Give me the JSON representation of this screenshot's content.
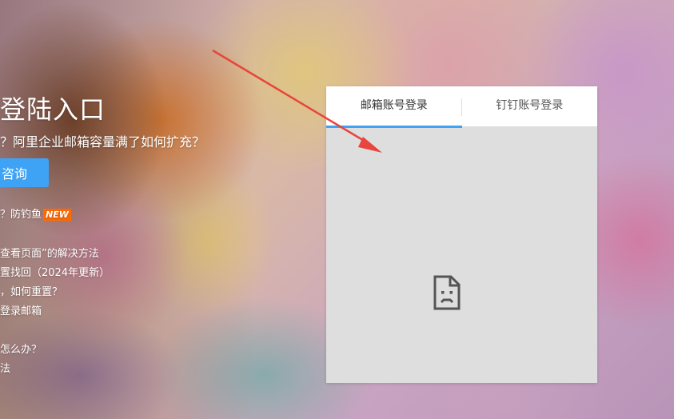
{
  "left": {
    "title": "登陆入口",
    "subtitle": "？阿里企业邮箱容量满了如何扩充？",
    "consult_button": "咨询",
    "notice": {
      "text": "？防钓鱼",
      "badge": "NEW"
    },
    "links": [
      "查看页面”的解决方法",
      "置找回（2024年更新）",
      "，如何重置？",
      "登录邮箱",
      "怎么办？",
      "法"
    ]
  },
  "login_panel": {
    "tabs": [
      {
        "label": "邮箱账号登录",
        "active": true
      },
      {
        "label": "钉钉账号登录",
        "active": false
      }
    ],
    "frame_state": "sad-page-icon",
    "accent_color": "#3fa3f5"
  },
  "annotation": {
    "arrow_color": "#e8453c"
  }
}
